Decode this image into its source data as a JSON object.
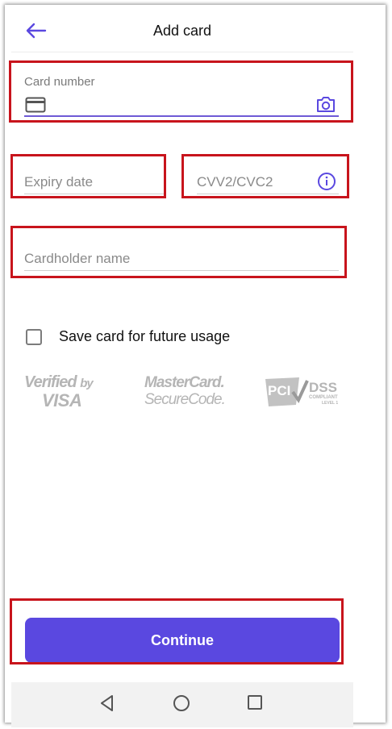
{
  "header": {
    "title": "Add card",
    "back_icon": "arrow-left-icon"
  },
  "form": {
    "card_number": {
      "label": "Card number",
      "value": "",
      "card_icon": "credit-card-icon",
      "scan_icon": "camera-icon"
    },
    "expiry": {
      "placeholder": "Expiry date",
      "value": ""
    },
    "cvv": {
      "placeholder": "CVV2/CVC2",
      "value": "",
      "info_icon": "info-icon"
    },
    "cardholder": {
      "placeholder": "Cardholder name",
      "value": ""
    },
    "save_card": {
      "label": "Save card for future usage",
      "checked": false
    }
  },
  "logos": {
    "verified_visa": {
      "line1": "Verified",
      "by": "by",
      "line2": "VISA"
    },
    "mastercard": {
      "line1": "MasterCard.",
      "line2": "SecureCode."
    },
    "pci": {
      "mark": "PCI",
      "dss": "DSS",
      "compliant": "COMPLIANT",
      "level": "LEVEL 1"
    }
  },
  "actions": {
    "continue_label": "Continue"
  },
  "navbar": {
    "back_icon": "nav-back-triangle-icon",
    "home_icon": "nav-home-circle-icon",
    "recents_icon": "nav-recents-square-icon"
  },
  "colors": {
    "accent": "#5a48e0",
    "highlight": "#c8141c"
  }
}
